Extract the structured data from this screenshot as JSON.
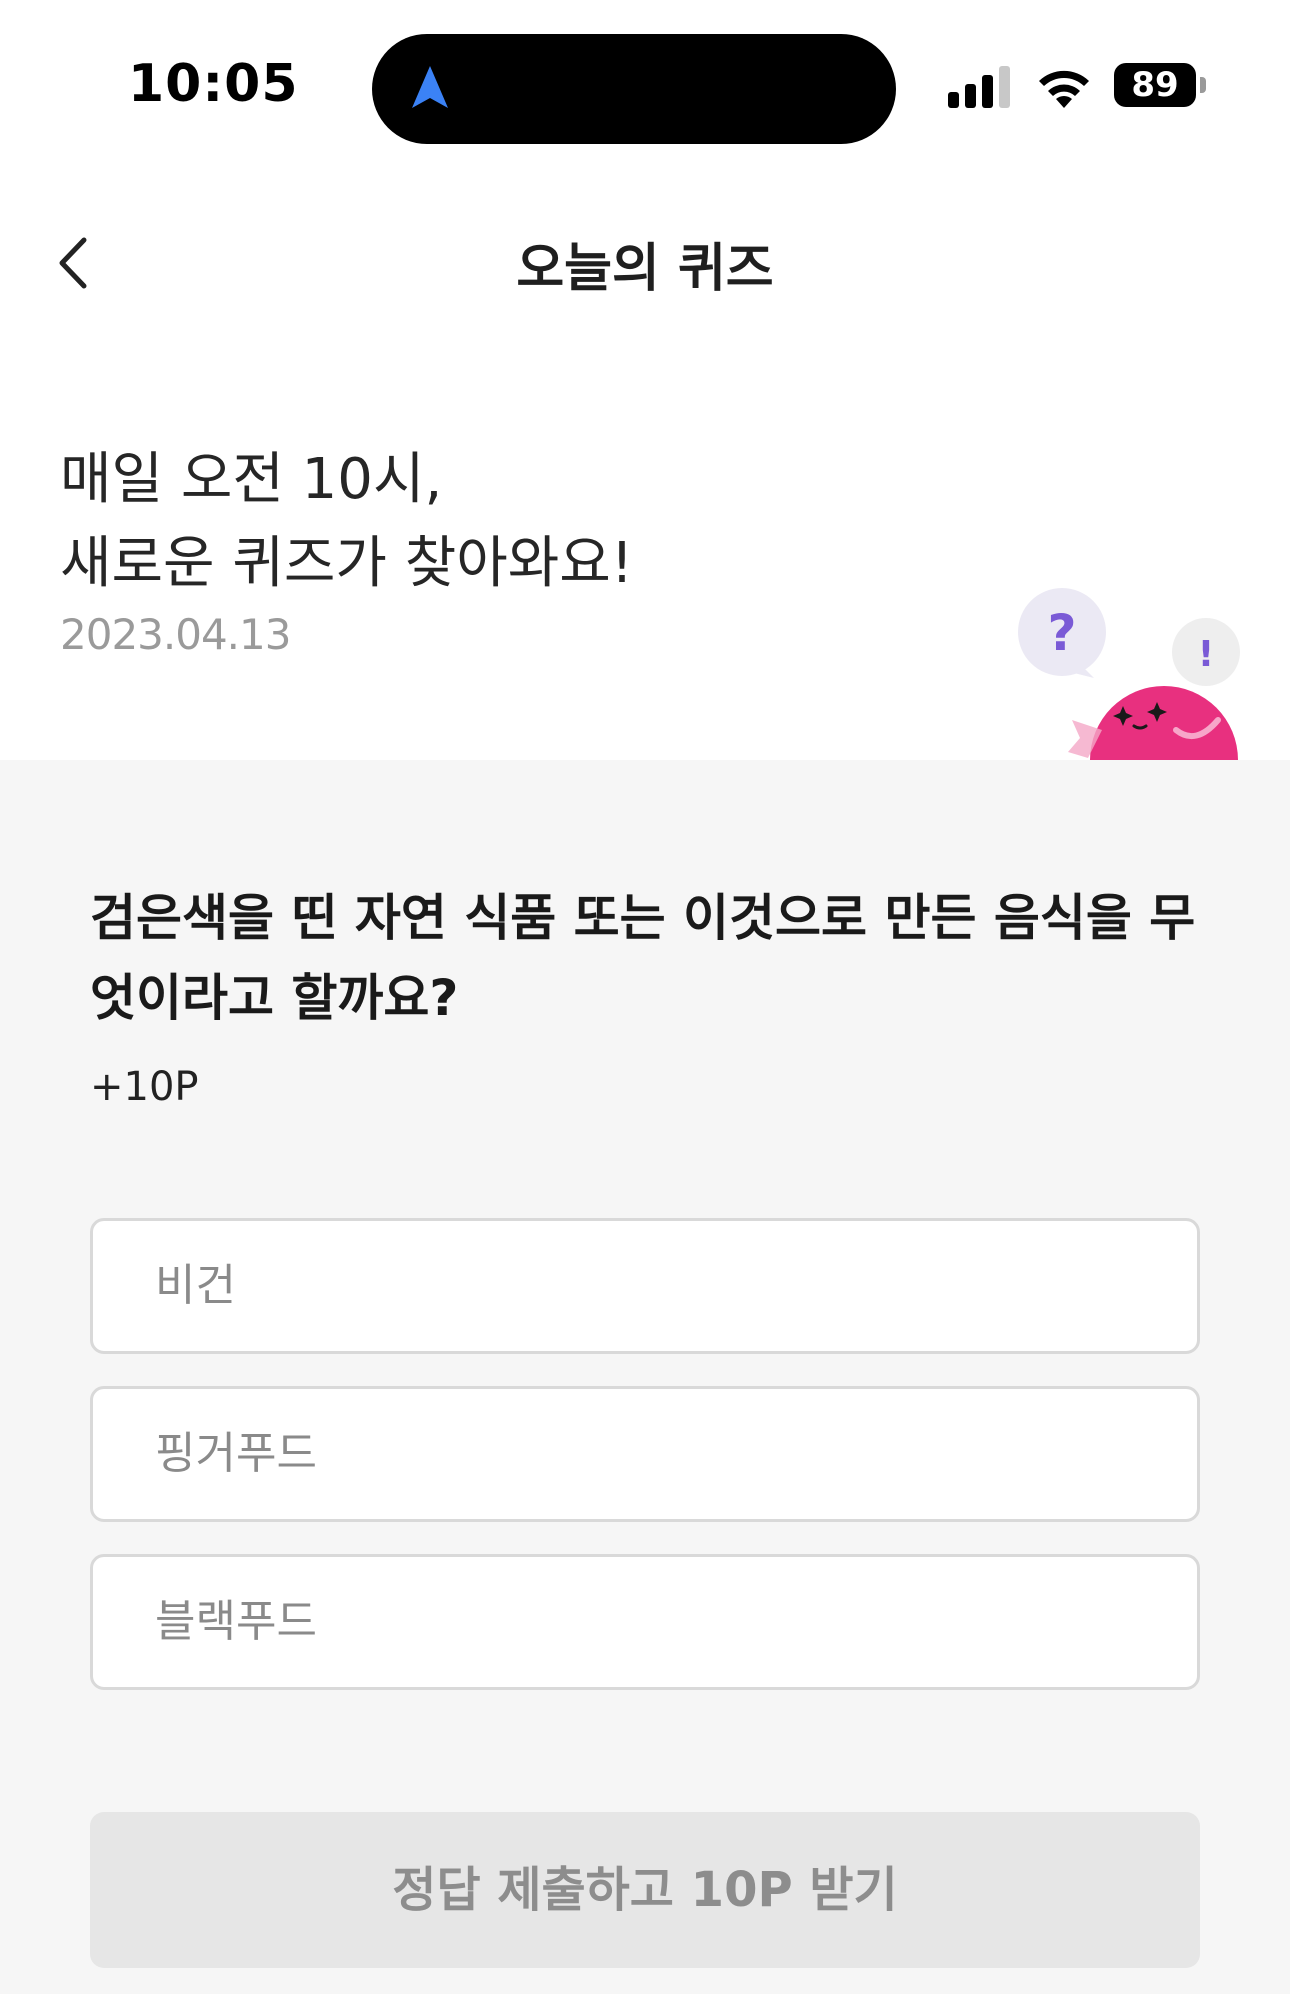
{
  "status_bar": {
    "time": "10:05",
    "battery": "89",
    "icons": [
      "location-arrow-icon",
      "cellular-signal-icon",
      "wifi-icon",
      "battery-icon"
    ]
  },
  "nav": {
    "title": "오늘의 퀴즈",
    "back_icon": "chevron-left-icon"
  },
  "intro": {
    "line1": "매일 오전 10시,",
    "line2": "새로운 퀴즈가 찾아와요!",
    "date": "2023.04.13"
  },
  "mascot": {
    "question_mark": "?",
    "exclamation_mark": "!"
  },
  "quiz": {
    "question": "검은색을 띤 자연 식품 또는 이것으로 만든 음식을 무엇이라고 할까요?",
    "points": "+10P",
    "options": [
      {
        "label": "비건"
      },
      {
        "label": "핑거푸드"
      },
      {
        "label": "블랙푸드"
      }
    ],
    "submit_label": "정답 제출하고 10P 받기"
  },
  "colors": {
    "panel_background": "#f6f6f6",
    "mascot_pink": "#e8307f",
    "bubble_purple": "#7a5ad6",
    "location_blue": "#3b82f6",
    "disabled_button": "#e6e6e6"
  }
}
